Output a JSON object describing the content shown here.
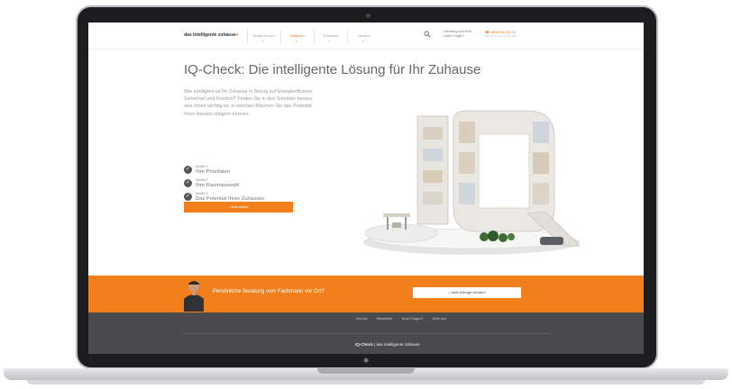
{
  "header": {
    "logo_text": "das intelligente zuhause",
    "nav": [
      {
        "label": "Smart Home?",
        "active": false
      },
      {
        "label": "Ratgeber",
        "active": true
      },
      {
        "label": "Produkte",
        "active": false
      },
      {
        "label": "Service",
        "active": false
      }
    ],
    "contact_line1": "• Beratung vom Profi",
    "contact_line2": "• Noch Fragen?",
    "phone": "☎ 0800 000 00 00",
    "hours": "Mo–Fr 8:00–20:00 Uhr"
  },
  "hero": {
    "title": "IQ-Check: Die intelligente Lösung für Ihr Zuhause",
    "intro": "Wie intelligent ist Ihr Zuhause in Bezug auf Energieeffizienz, Sicherheit und Komfort? Finden Sie in drei Schritten heraus, was Ihnen wichtig ist, in welchen Räumen Sie das Potential Ihres Hauses steigern können.",
    "steps": [
      {
        "label": "Schritt 1:",
        "text": "Ihre Prioritäten"
      },
      {
        "label": "Schritt 2:",
        "text": "Ihre Raumauswahl"
      },
      {
        "label": "Schritt 3:",
        "text": "Das Potential Ihres Zuhauses"
      }
    ],
    "cta_label": "› Jetzt starten",
    "illustration": "iq-letters-house-cutaway"
  },
  "advice_band": {
    "text": "Persönliche Beratung vom Fachmann vor Ort?",
    "button_label": "› Jetzt Anfrage senden!"
  },
  "footer": {
    "links": [
      "Service",
      "Newsletter",
      "Noch Fragen?",
      "Über uns"
    ],
    "brand_prefix": "IQ-Check",
    "brand_suffix": "das intelligente zuhause"
  },
  "colors": {
    "accent": "#f07f1c",
    "footer_bg": "#4b4b4d",
    "text_grey": "#666666"
  }
}
